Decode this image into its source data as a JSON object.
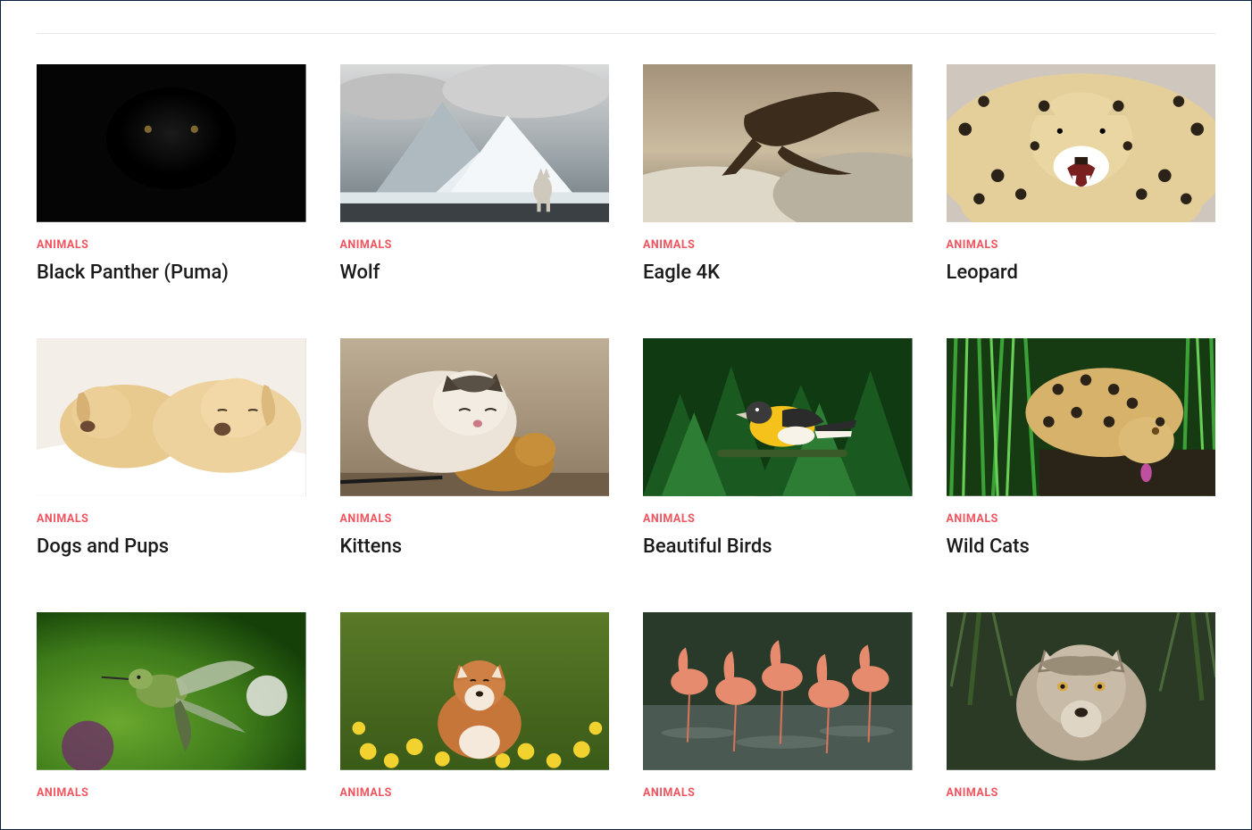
{
  "category_label": "ANIMALS",
  "gallery": {
    "items": [
      {
        "title": "Black Panther (Puma)",
        "thumb": "panther"
      },
      {
        "title": "Wolf",
        "thumb": "mountain-wolf"
      },
      {
        "title": "Eagle 4K",
        "thumb": "eagle"
      },
      {
        "title": "Leopard",
        "thumb": "leopard"
      },
      {
        "title": "Dogs and Pups",
        "thumb": "pups"
      },
      {
        "title": "Kittens",
        "thumb": "kitten"
      },
      {
        "title": "Beautiful Birds",
        "thumb": "bird"
      },
      {
        "title": "Wild Cats",
        "thumb": "wildcat"
      },
      {
        "title": "",
        "thumb": "hummingbird"
      },
      {
        "title": "",
        "thumb": "shiba"
      },
      {
        "title": "",
        "thumb": "flamingos"
      },
      {
        "title": "",
        "thumb": "wolf-face"
      }
    ]
  }
}
